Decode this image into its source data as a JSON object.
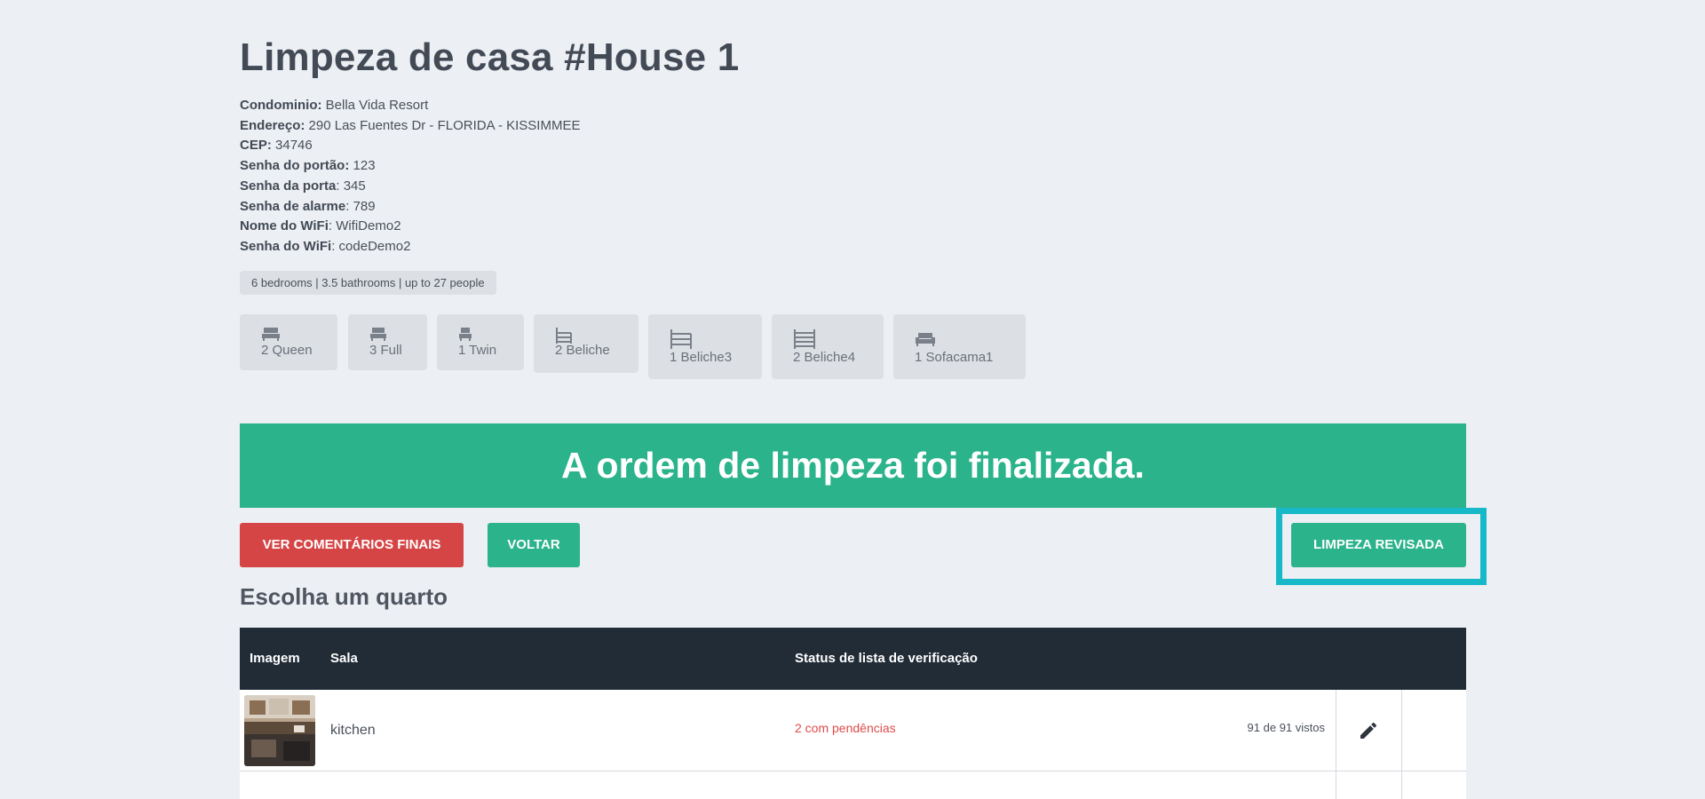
{
  "page": {
    "title": "Limpeza de casa #House 1"
  },
  "info": [
    {
      "label": "Condominio:",
      "value": " Bella Vida Resort"
    },
    {
      "label": "Endereço:",
      "value": " 290 Las Fuentes Dr - FLORIDA - KISSIMMEE"
    },
    {
      "label": "CEP:",
      "value": " 34746"
    },
    {
      "label": "Senha do portão:",
      "value": " 123"
    },
    {
      "label": "Senha da porta",
      "value": ": 345"
    },
    {
      "label": "Senha de alarme",
      "value": ": 789"
    },
    {
      "label": "Nome do WiFi",
      "value": ": WifiDemo2"
    },
    {
      "label": "Senha do WiFi",
      "value": ": codeDemo2"
    }
  ],
  "summary": "6 bedrooms | 3.5 bathrooms | up to 27 people",
  "beds": [
    {
      "label": "2 Queen",
      "icon": "bed-icon"
    },
    {
      "label": "3 Full",
      "icon": "bed-icon"
    },
    {
      "label": "1 Twin",
      "icon": "single-bed-icon"
    },
    {
      "label": "2 Beliche",
      "icon": "bunk-bed-icon"
    },
    {
      "label": "1 Beliche3",
      "icon": "bunk-bed-3-icon"
    },
    {
      "label": "2 Beliche4",
      "icon": "bunk-bed-4-icon"
    },
    {
      "label": "1 Sofacama1",
      "icon": "sofa-bed-icon"
    }
  ],
  "banner": "A ordem de limpeza foi finalizada.",
  "actions": {
    "final_comments": "VER COMENTÁRIOS FINAIS",
    "back": "VOLTAR",
    "reviewed": "LIMPEZA REVISADA"
  },
  "section_title": "Escolha um quarto",
  "table": {
    "headers": {
      "image": "Imagem",
      "room": "Sala",
      "status": "Status de lista de verificação"
    },
    "rows": [
      {
        "room": "kitchen",
        "status": "2 com pendências",
        "count": "91 de 91 vistos",
        "action_icon": "pencil-icon"
      }
    ]
  },
  "colors": {
    "accent_green": "#2bb38b",
    "danger_red": "#d64545",
    "highlight_cyan": "#17b9c9",
    "table_header": "#222c36"
  }
}
